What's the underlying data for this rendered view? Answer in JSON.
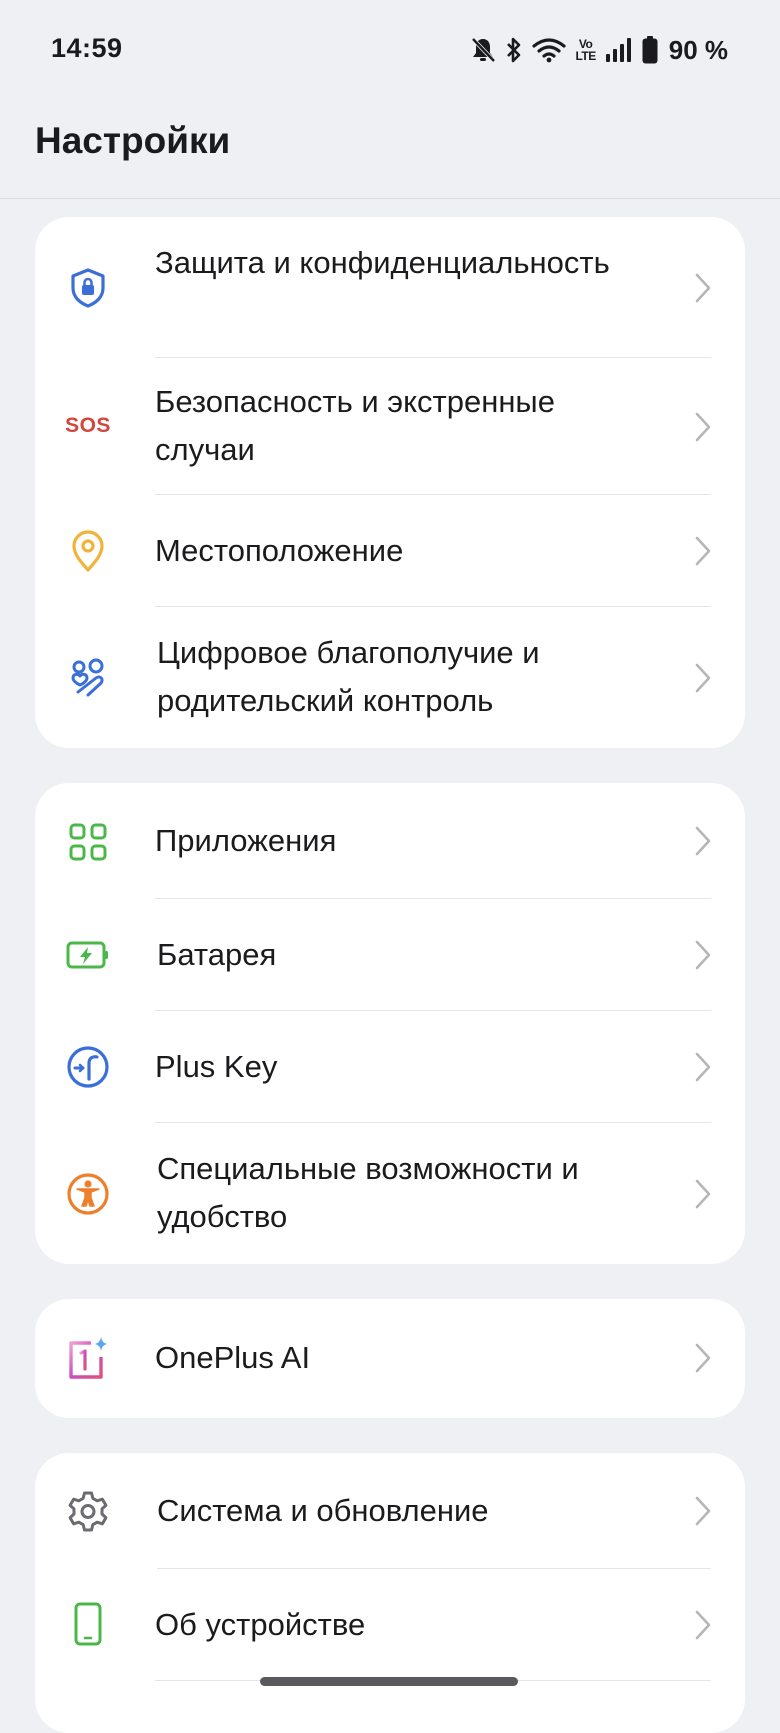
{
  "status_bar": {
    "time": "14:59",
    "volte_top": "Vo",
    "volte_bottom": "LTE",
    "battery_percent": "90 %",
    "icons": [
      "bell-muted-icon",
      "bluetooth-icon",
      "wifi-icon",
      "volte-icon",
      "signal-icon",
      "battery-icon"
    ]
  },
  "header": {
    "title": "Настройки"
  },
  "groups": [
    {
      "items": [
        {
          "label": "Защита и конфиденциальность",
          "icon": "shield-lock-icon",
          "color": "#3b6fd8"
        },
        {
          "label": "Безопасность и экстренные случаи",
          "icon": "sos-icon",
          "icon_text": "SOS",
          "color": "#d2473b"
        },
        {
          "label": "Местоположение",
          "icon": "location-pin-icon",
          "color": "#f0b43a"
        },
        {
          "label": "Цифровое благополучие и родительский контроль",
          "icon": "family-heart-icon",
          "color": "#3b6fd8"
        }
      ]
    },
    {
      "items": [
        {
          "label": "Приложения",
          "icon": "apps-grid-icon",
          "color": "#4bb749"
        },
        {
          "label": "Батарея",
          "icon": "battery-charging-icon",
          "color": "#4bb749"
        },
        {
          "label": "Plus Key",
          "icon": "plus-key-icon",
          "color": "#3b6fd8"
        },
        {
          "label": "Специальные возможности и удобство",
          "icon": "accessibility-icon",
          "color": "#ee7f2d"
        }
      ]
    },
    {
      "items": [
        {
          "label": "OnePlus AI",
          "icon": "oneplus-ai-icon",
          "color": "#c64fbf"
        }
      ]
    },
    {
      "items": [
        {
          "label": "Система и обновление",
          "icon": "gear-icon",
          "color": "#6b6b70"
        },
        {
          "label": "Об устройстве",
          "icon": "phone-icon",
          "color": "#4bb749"
        }
      ]
    }
  ]
}
